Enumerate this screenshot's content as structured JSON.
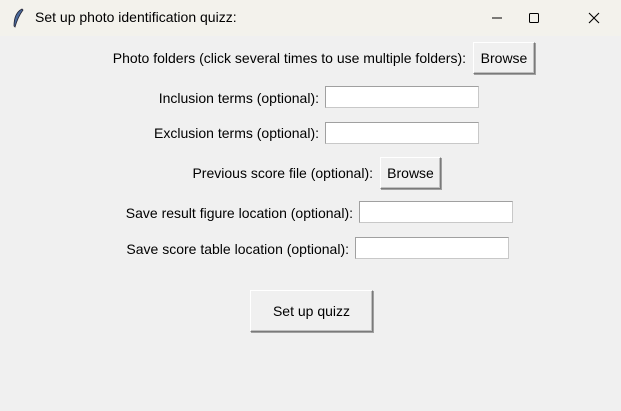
{
  "window": {
    "title": "Set up photo identification quizz:",
    "icon": "feather-icon"
  },
  "rows": {
    "photo_folders": {
      "label": "Photo folders (click several times to use multiple folders):",
      "button": "Browse"
    },
    "inclusion": {
      "label": "Inclusion terms (optional):",
      "value": ""
    },
    "exclusion": {
      "label": "Exclusion terms (optional):",
      "value": ""
    },
    "previous_score": {
      "label": "Previous score file (optional):",
      "button": "Browse"
    },
    "result_figure": {
      "label": "Save result figure location (optional):",
      "value": ""
    },
    "score_table": {
      "label": "Save score table location (optional):",
      "value": ""
    }
  },
  "submit": {
    "label": "Set up quizz"
  }
}
